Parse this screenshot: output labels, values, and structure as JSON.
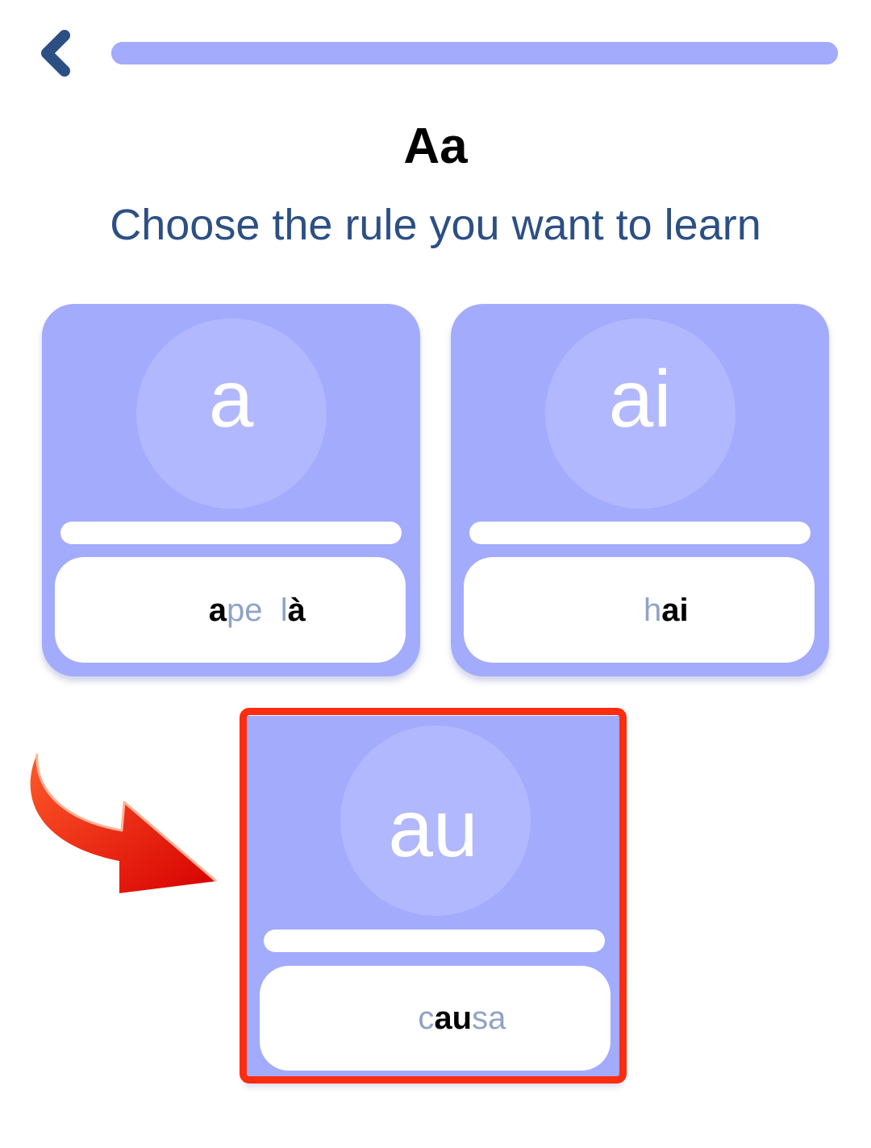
{
  "header": {
    "back_icon": "chevron-left-icon",
    "progress_percent": 100
  },
  "title": "Aa",
  "subtitle": "Choose the rule you want to learn",
  "cards": [
    {
      "glyph": "a",
      "word_parts": [
        {
          "text": "a",
          "highlight": true
        },
        {
          "text": "pe  ",
          "highlight": false
        },
        {
          "text": "l",
          "highlight": false
        },
        {
          "text": "à",
          "highlight": true
        }
      ]
    },
    {
      "glyph": "ai",
      "word_parts": [
        {
          "text": "h",
          "highlight": false
        },
        {
          "text": "ai",
          "highlight": true
        }
      ]
    },
    {
      "glyph": "au",
      "selected": true,
      "word_parts": [
        {
          "text": "c",
          "highlight": false
        },
        {
          "text": "au",
          "highlight": true
        },
        {
          "text": "sa",
          "highlight": false
        }
      ]
    }
  ],
  "colors": {
    "card": "#a3abfc",
    "circle": "#b1b8fd",
    "subtitle": "#2c4f84",
    "dim_letters": "#8fa3c6",
    "selection": "#ff2d0f"
  }
}
